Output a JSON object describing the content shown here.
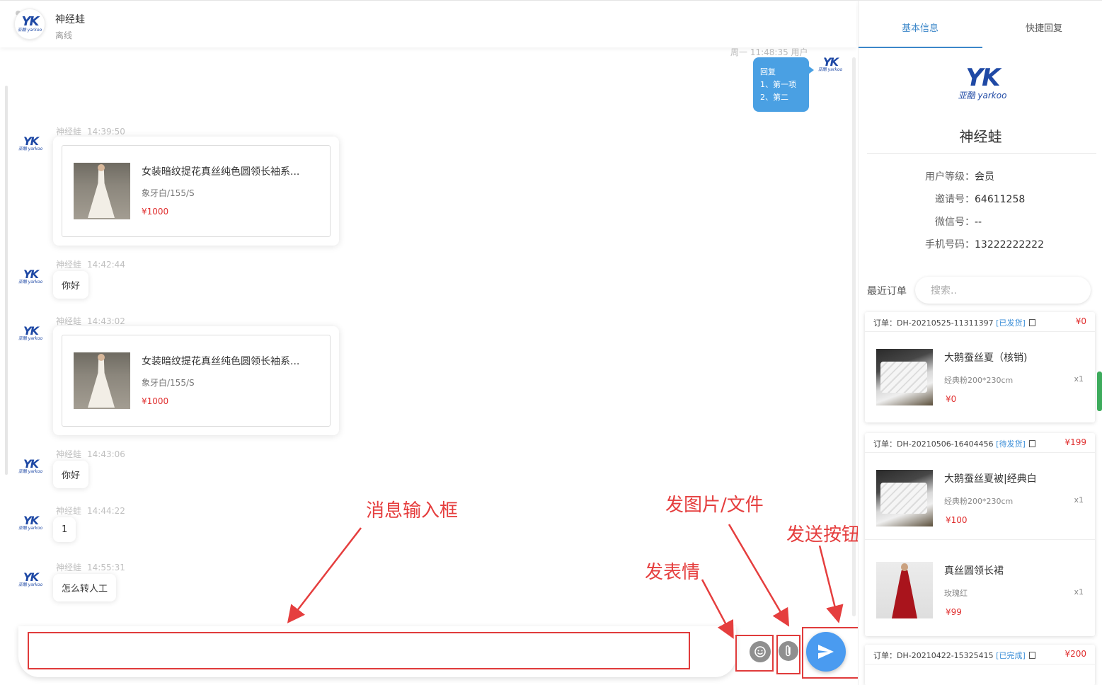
{
  "header": {
    "name": "神经蛙",
    "status": "离线"
  },
  "logo": {
    "mark": "YK",
    "sub": "亚酷 yarkoo"
  },
  "self_message": {
    "meta": "周一 11:48:35  用户",
    "lines": [
      "回复",
      "1、第一项",
      "2、第二"
    ]
  },
  "messages": [
    {
      "sender": "神经蛙",
      "time": "14:39:50",
      "type": "product",
      "title": "女装暗纹提花真丝纯色圆领长袖系...",
      "spec": "象牙白/155/S",
      "price": "¥1000"
    },
    {
      "sender": "神经蛙",
      "time": "14:42:44",
      "type": "text",
      "text": "你好"
    },
    {
      "sender": "神经蛙",
      "time": "14:43:02",
      "type": "product",
      "title": "女装暗纹提花真丝纯色圆领长袖系...",
      "spec": "象牙白/155/S",
      "price": "¥1000"
    },
    {
      "sender": "神经蛙",
      "time": "14:43:06",
      "type": "text",
      "text": "你好"
    },
    {
      "sender": "神经蛙",
      "time": "14:44:22",
      "type": "text",
      "text": "1"
    },
    {
      "sender": "神经蛙",
      "time": "14:55:31",
      "type": "text",
      "text": "怎么转人工"
    }
  ],
  "input": {
    "value": "",
    "placeholder": ""
  },
  "annotations": {
    "input": "消息输入框",
    "file": "发图片/文件",
    "emoji": "发表情",
    "send": "发送按钮"
  },
  "tabs": {
    "basic": "基本信息",
    "quick": "快捷回复"
  },
  "profile": {
    "name": "神经蛙",
    "fields": [
      {
        "label": "用户等级：",
        "value": "会员"
      },
      {
        "label": "邀请号：",
        "value": "64611258"
      },
      {
        "label": "微信号：",
        "value": "--"
      },
      {
        "label": "手机号码：",
        "value": "13222222222"
      }
    ]
  },
  "orders_section": {
    "label": "最近订单",
    "search_placeholder": "搜索.."
  },
  "orders": [
    {
      "no": "订单：DH-20210525-11311397",
      "status": "[已发货]",
      "total": "¥0",
      "items": [
        {
          "title": "大鹅蚕丝夏（核销)",
          "spec": "经典粉200*230cm",
          "qty": "x1",
          "price": "¥0"
        }
      ]
    },
    {
      "no": "订单：DH-20210506-16404456",
      "status": "[待发货]",
      "total": "¥199",
      "items": [
        {
          "title": "大鹅蚕丝夏被|经典白",
          "spec": "经典粉200*230cm",
          "qty": "x1",
          "price": "¥100"
        },
        {
          "title": "真丝圆领长裙",
          "spec": "玫瑰红",
          "qty": "x1",
          "price": "¥99"
        }
      ]
    },
    {
      "no": "订单：DH-20210422-15325415",
      "status": "[已完成]",
      "total": "¥200",
      "items": []
    }
  ],
  "colors": {
    "accent": "#4a9bf0",
    "tab": "#3c87c9",
    "price": "#e02e2e",
    "annotation": "#e53e3e"
  }
}
